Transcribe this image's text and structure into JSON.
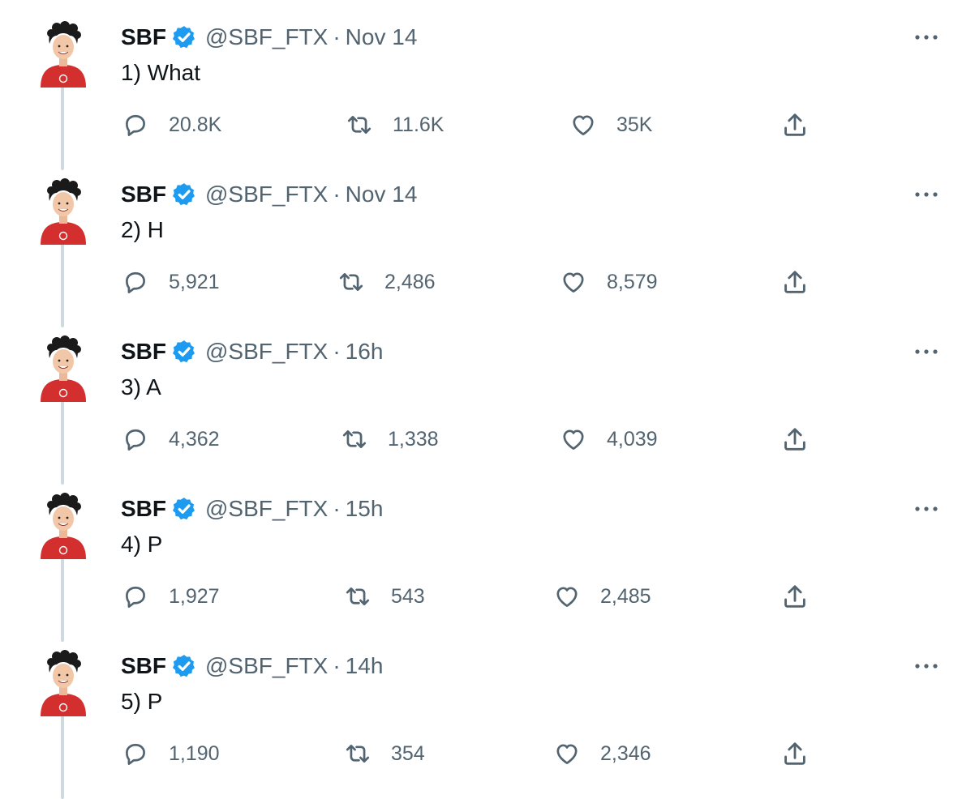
{
  "colors": {
    "verified": "#1d9bf0",
    "secondary_text": "#536471",
    "thread_line": "#cfd9de",
    "avatar_shirt": "#d32f2f"
  },
  "icons": {
    "reply": "reply-icon",
    "retweet": "retweet-icon",
    "like": "heart-icon",
    "share": "share-icon",
    "more": "more-icon",
    "verified": "verified-badge-icon"
  },
  "tweets": [
    {
      "name": "SBF",
      "handle": "@SBF_FTX",
      "separator": "·",
      "time": "Nov 14",
      "text": "1) What",
      "replies": "20.8K",
      "retweets": "11.6K",
      "likes": "35K"
    },
    {
      "name": "SBF",
      "handle": "@SBF_FTX",
      "separator": "·",
      "time": "Nov 14",
      "text": "2) H",
      "replies": "5,921",
      "retweets": "2,486",
      "likes": "8,579"
    },
    {
      "name": "SBF",
      "handle": "@SBF_FTX",
      "separator": "·",
      "time": "16h",
      "text": "3) A",
      "replies": "4,362",
      "retweets": "1,338",
      "likes": "4,039"
    },
    {
      "name": "SBF",
      "handle": "@SBF_FTX",
      "separator": "·",
      "time": "15h",
      "text": "4) P",
      "replies": "1,927",
      "retweets": "543",
      "likes": "2,485"
    },
    {
      "name": "SBF",
      "handle": "@SBF_FTX",
      "separator": "·",
      "time": "14h",
      "text": "5) P",
      "replies": "1,190",
      "retweets": "354",
      "likes": "2,346"
    }
  ]
}
